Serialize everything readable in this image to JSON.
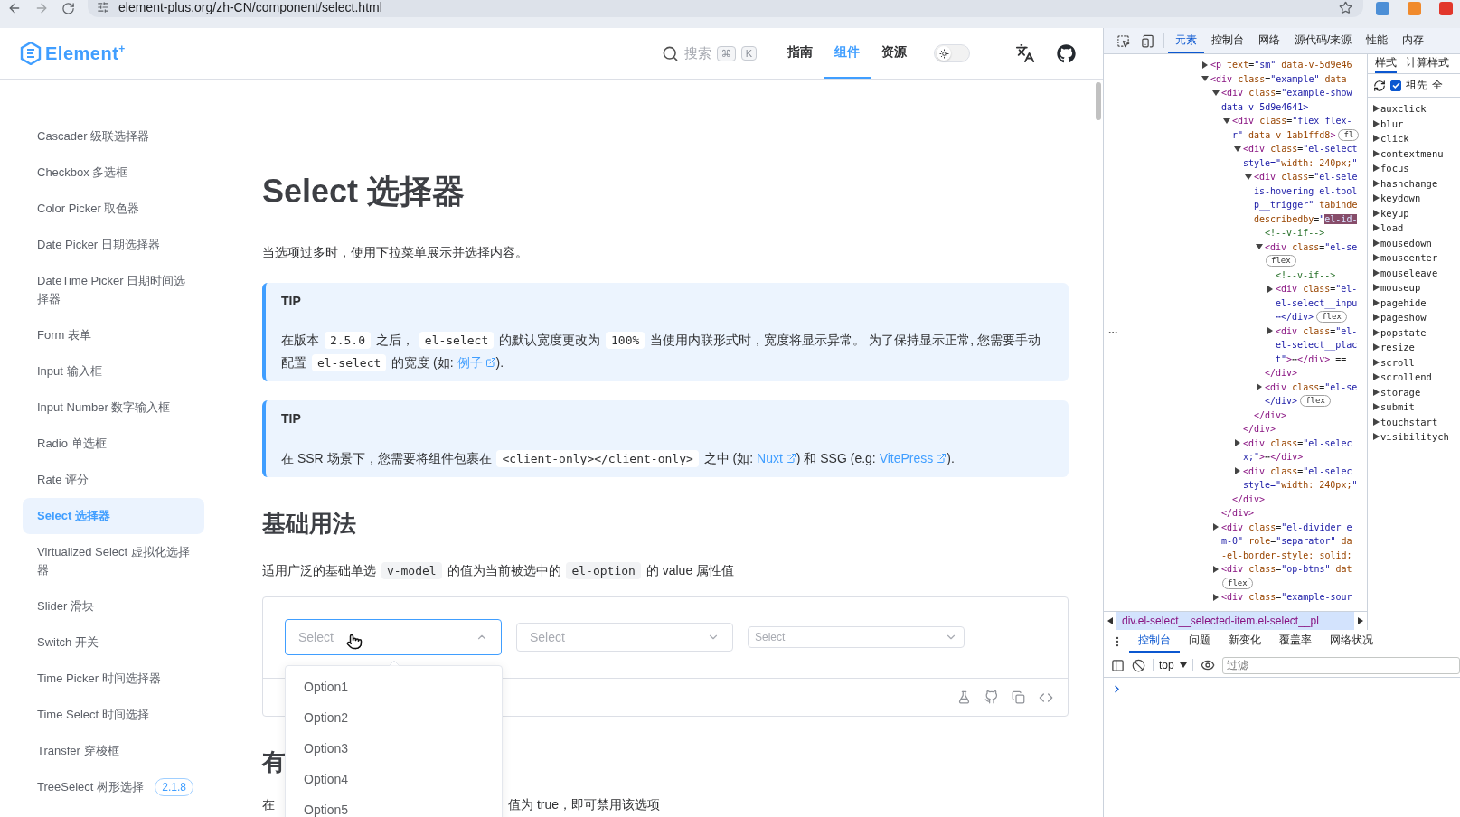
{
  "browser": {
    "url": "element-plus.org/zh-CN/component/select.html"
  },
  "header": {
    "logo": "Element",
    "logo_sup": "+",
    "search": {
      "label": "搜索",
      "keys": [
        "⌘",
        "K"
      ]
    },
    "nav": [
      {
        "label": "指南",
        "selected": false
      },
      {
        "label": "组件",
        "selected": true
      },
      {
        "label": "资源",
        "selected": false
      }
    ],
    "theme_switch": {
      "on": false
    }
  },
  "sidebar": {
    "items": [
      {
        "label": "Cascader 级联选择器",
        "selected": false
      },
      {
        "label": "Checkbox 多选框",
        "selected": false
      },
      {
        "label": "Color Picker 取色器",
        "selected": false
      },
      {
        "label": "Date Picker 日期选择器",
        "selected": false
      },
      {
        "label": "DateTime Picker 日期时间选择器",
        "selected": false
      },
      {
        "label": "Form 表单",
        "selected": false
      },
      {
        "label": "Input 输入框",
        "selected": false
      },
      {
        "label": "Input Number 数字输入框",
        "selected": false
      },
      {
        "label": "Radio 单选框",
        "selected": false
      },
      {
        "label": "Rate 评分",
        "selected": false
      },
      {
        "label": "Select 选择器",
        "selected": true
      },
      {
        "label": "Virtualized Select 虚拟化选择器",
        "selected": false
      },
      {
        "label": "Slider 滑块",
        "selected": false
      },
      {
        "label": "Switch 开关",
        "selected": false
      },
      {
        "label": "Time Picker 时间选择器",
        "selected": false
      },
      {
        "label": "Time Select 时间选择",
        "selected": false
      },
      {
        "label": "Transfer 穿梭框",
        "selected": false
      },
      {
        "label": "TreeSelect 树形选择",
        "selected": false,
        "badge": "2.1.8"
      }
    ]
  },
  "content": {
    "title": "Select 选择器",
    "intro": "当选项过多时，使用下拉菜单展示并选择内容。",
    "tips": [
      {
        "label": "TIP",
        "segments": [
          {
            "kind": "text",
            "text": "在版本 "
          },
          {
            "kind": "code",
            "text": "2.5.0"
          },
          {
            "kind": "text",
            "text": " 之后， "
          },
          {
            "kind": "code",
            "text": "el-select"
          },
          {
            "kind": "text",
            "text": " 的默认宽度更改为 "
          },
          {
            "kind": "code",
            "text": "100%"
          },
          {
            "kind": "text",
            "text": " 当使用内联形式时，宽度将显示异常。 为了保持显示正常, 您需要手动配置 "
          },
          {
            "kind": "code",
            "text": "el-select"
          },
          {
            "kind": "text",
            "text": " 的宽度 (如: "
          },
          {
            "kind": "link",
            "text": "例子"
          },
          {
            "kind": "text",
            "text": ")."
          }
        ]
      },
      {
        "label": "TIP",
        "segments": [
          {
            "kind": "text",
            "text": "在 SSR 场景下，您需要将组件包裹在 "
          },
          {
            "kind": "code",
            "text": "<client-only></client-only>"
          },
          {
            "kind": "text",
            "text": " 之中 (如: "
          },
          {
            "kind": "link",
            "text": "Nuxt"
          },
          {
            "kind": "text",
            "text": ") 和 SSG (e.g: "
          },
          {
            "kind": "link",
            "text": "VitePress"
          },
          {
            "kind": "text",
            "text": ")."
          }
        ]
      }
    ],
    "section_title": "基础用法",
    "section_text": [
      {
        "kind": "text",
        "text": "适用广泛的基础单选 "
      },
      {
        "kind": "code",
        "text": "v-model"
      },
      {
        "kind": "text",
        "text": " 的值为当前被选中的 "
      },
      {
        "kind": "code",
        "text": "el-option"
      },
      {
        "kind": "text",
        "text": " 的 value 属性值"
      }
    ],
    "selects": [
      {
        "kind": "large",
        "placeholder": "Select",
        "expanded": true,
        "options": [
          "Option1",
          "Option2",
          "Option3",
          "Option4",
          "Option5"
        ]
      },
      {
        "kind": "default",
        "placeholder": "Select",
        "expanded": false
      },
      {
        "kind": "small",
        "placeholder": "Select",
        "expanded": false
      }
    ],
    "next_title": "有",
    "next_text": [
      "在",
      "值为 true，即可禁用该选项"
    ]
  },
  "devtools": {
    "tabs": [
      {
        "label": "元素",
        "selected": true
      },
      {
        "label": "控制台",
        "selected": false
      },
      {
        "label": "网络",
        "selected": false
      },
      {
        "label": "源代码/来源",
        "selected": false
      },
      {
        "label": "性能",
        "selected": false
      },
      {
        "label": "内存",
        "selected": false
      }
    ],
    "dom": [
      {
        "kind": "element",
        "expanded": false,
        "lines": [
          "<p text=\"sm\" data-v-5d9e46"
        ]
      },
      {
        "kind": "element",
        "expanded": true,
        "lines": [
          "<div class=\"example\" data-"
        ],
        "children": [
          {
            "kind": "element",
            "expanded": true,
            "lines": [
              "<div class=\"example-show",
              "data-v-5d9e4641>"
            ],
            "closing": "</div>",
            "children": [
              {
                "kind": "element",
                "expanded": true,
                "lines": [
                  "<div class=\"flex flex-",
                  "r\" data-v-1ab1ffd8>"
                ],
                "badge": "fl",
                "closing": "</div>",
                "children": [
                  {
                    "kind": "element",
                    "expanded": true,
                    "lines": [
                      "<div class=\"el-select",
                      "style=\"width: 240px;\""
                    ],
                    "closing": "</div>",
                    "children": [
                      {
                        "kind": "element",
                        "expanded": true,
                        "lines": [
                          "<div class=\"el-sele",
                          "is-hovering el-tool",
                          "p__trigger\" tabinde",
                          "describedby=\""
                        ],
                        "highlight": "el-id-",
                        "closing": "</div>",
                        "children": [
                          {
                            "kind": "comment",
                            "lines": [
                              "<!--v-if-->"
                            ]
                          },
                          {
                            "kind": "element",
                            "expanded": true,
                            "lines": [
                              "<div class=\"el-se"
                            ],
                            "badge": "flex",
                            "badge_own_line": true,
                            "closing": "</div>",
                            "children": [
                              {
                                "kind": "comment",
                                "lines": [
                                  "<!--v-if-->"
                                ]
                              },
                              {
                                "kind": "element",
                                "expanded": false,
                                "lines": [
                                  "<div class=\"el-",
                                  "el-select__inpu",
                                  "⋯</div>"
                                ],
                                "badge": "flex"
                              },
                              {
                                "kind": "element",
                                "expanded": false,
                                "lines": [
                                  "<div class=\"el-",
                                  "el-select__plac",
                                  "t\">⋯</div> =="
                                ]
                              }
                            ]
                          },
                          {
                            "kind": "element",
                            "expanded": false,
                            "lines": [
                              "<div class=\"el-se",
                              "</div>"
                            ],
                            "badge": "flex"
                          }
                        ]
                      }
                    ]
                  },
                  {
                    "kind": "element",
                    "expanded": false,
                    "lines": [
                      "<div class=\"el-selec",
                      "x;\">⋯</div>"
                    ]
                  },
                  {
                    "kind": "element",
                    "expanded": false,
                    "lines": [
                      "<div class=\"el-selec",
                      "style=\"width: 240px;\""
                    ]
                  }
                ]
              }
            ]
          },
          {
            "kind": "element",
            "expanded": false,
            "lines": [
              "<div class=\"el-divider e",
              "m-0\" role=\"separator\" da",
              "-el-border-style: solid;"
            ]
          },
          {
            "kind": "element",
            "expanded": false,
            "lines": [
              "<div class=\"op-btns\" dat"
            ],
            "badge": "flex",
            "badge_own_line": true
          },
          {
            "kind": "element",
            "expanded": false,
            "lines": [
              "<div class=\"example-sour"
            ]
          }
        ]
      }
    ],
    "styles_tabs": [
      {
        "label": "样式",
        "selected": true
      },
      {
        "label": "计算样式",
        "selected": false
      }
    ],
    "ancestors": {
      "label": "祖先",
      "checked": true
    },
    "cut_label": "全",
    "events": [
      "auxclick",
      "blur",
      "click",
      "contextmenu",
      "focus",
      "hashchange",
      "keydown",
      "keyup",
      "load",
      "mousedown",
      "mouseenter",
      "mouseleave",
      "mouseup",
      "pagehide",
      "pageshow",
      "popstate",
      "resize",
      "scroll",
      "scrollend",
      "storage",
      "submit",
      "touchstart",
      "visibilitych"
    ],
    "breadcrumb": "div.el-select__selected-item.el-select__pl",
    "drawer_tabs": [
      {
        "label": "控制台",
        "selected": true
      },
      {
        "label": "问题",
        "selected": false
      },
      {
        "label": "新变化",
        "selected": false
      },
      {
        "label": "覆盖率",
        "selected": false
      },
      {
        "label": "网络状况",
        "selected": false
      }
    ],
    "context": "top",
    "filter": {
      "placeholder": "过滤"
    }
  }
}
